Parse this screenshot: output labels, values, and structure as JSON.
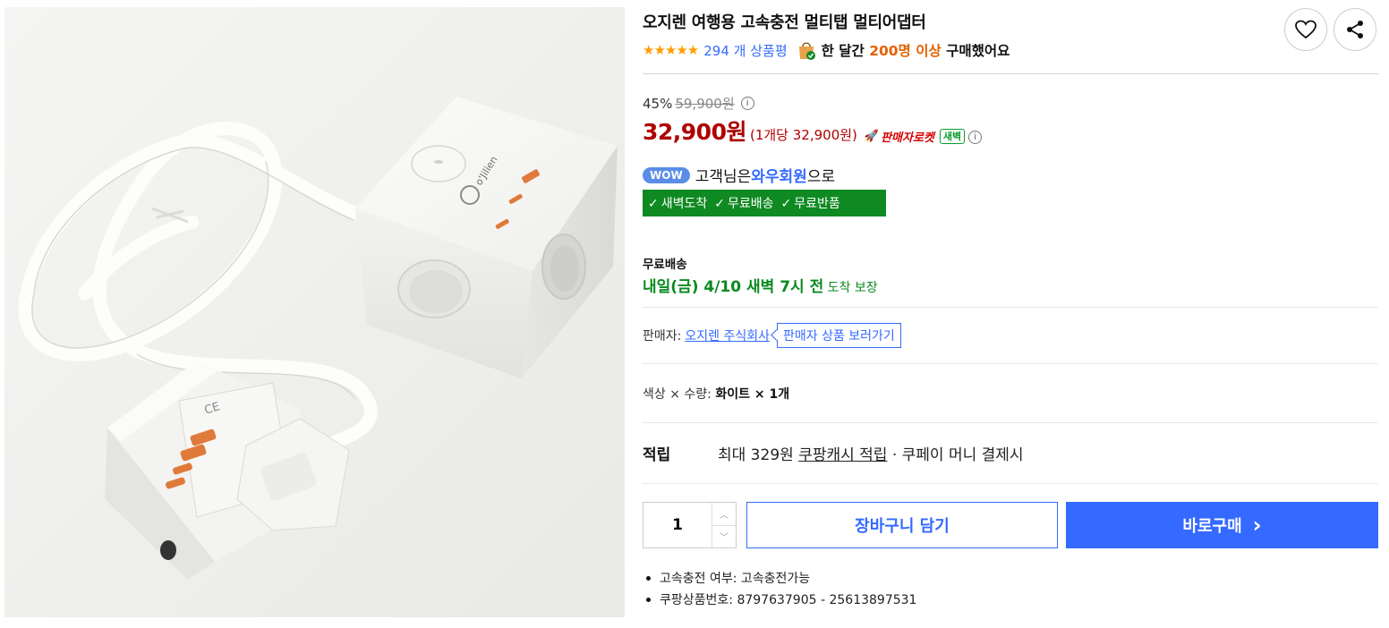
{
  "product": {
    "title": "오지렌 여행용 고속충전 멀티탭 멀티어댑터",
    "image_brand_text": "o'Jilien"
  },
  "rating": {
    "stars": "★★★★★",
    "star_value": 5,
    "review_count_text": "294 개 상품평",
    "buyers_prefix": "한 달간 ",
    "buyers_highlight": "200명 이상",
    "buyers_suffix": " 구매했어요"
  },
  "pricing": {
    "discount_rate": "45%",
    "original_price": "59,900원",
    "info_glyph": "i",
    "sale_price": "32,900원",
    "unit_price": "(1개당 32,900원)",
    "rocket_label": "판매자로켓",
    "dawn_badge": "새벽"
  },
  "wow": {
    "badge": "WOW",
    "prefix": "고객님은 ",
    "member": "와우회원",
    "suffix": "으로"
  },
  "benefits": [
    "새벽도착",
    "무료배송",
    "무료반품"
  ],
  "shipping": {
    "label": "무료배송",
    "date": "내일(금) 4/10 새벽 7시 전",
    "date_suffix": " 도착 보장"
  },
  "seller": {
    "label": "판매자:",
    "name": "오지렌 주식회사",
    "button": "판매자 상품 보러가기"
  },
  "option": {
    "label": "색상 × 수량: ",
    "value": "화이트 × 1개"
  },
  "points": {
    "label": "적립",
    "prefix": "최대 329원 ",
    "link": "쿠팡캐시 적립",
    "suffix": " · 쿠페이 머니 결제시"
  },
  "purchase": {
    "quantity": "1",
    "cart_label": "장바구니 담기",
    "buy_label": "바로구매",
    "buy_arrow": "›"
  },
  "specs": [
    "고속충전 여부: 고속충전가능",
    "쿠팡상품번호: 8797637905 - 25613897531"
  ],
  "colors": {
    "accent_blue": "#346aff",
    "price_red": "#ae0000",
    "delivery_green": "#0a8a1e",
    "star_orange": "#ff9d00"
  },
  "icons": {
    "heart": "heart-icon",
    "share": "share-icon",
    "bag": "shopping-bag-icon",
    "info": "info-icon",
    "rocket": "rocket-icon",
    "check": "check-icon",
    "up": "chevron-up-icon",
    "down": "chevron-down-icon"
  }
}
